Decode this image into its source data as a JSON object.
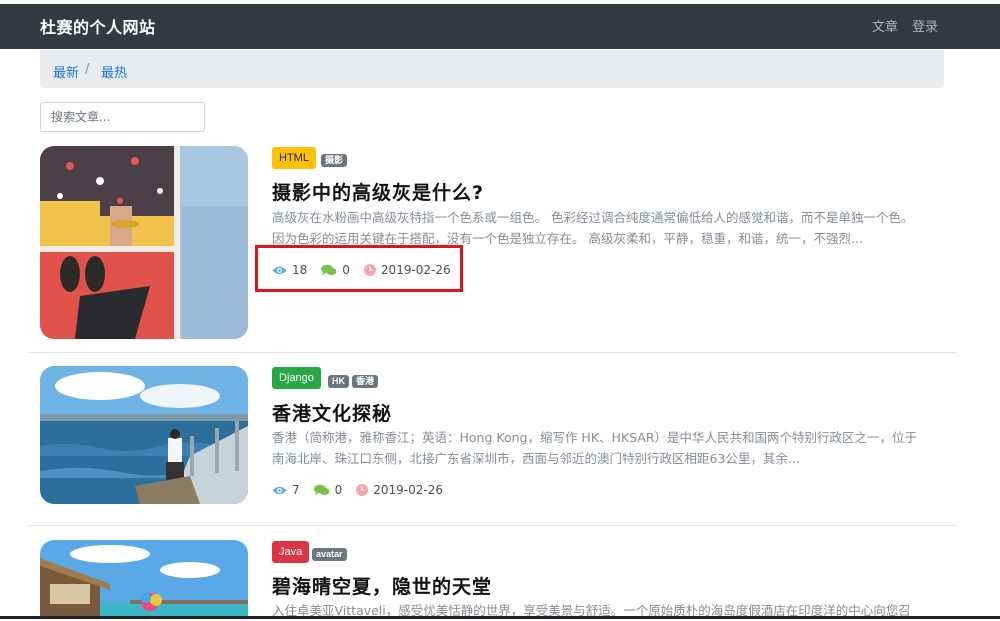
{
  "navbar": {
    "brand": "杜赛的个人网站",
    "links": [
      "文章",
      "登录"
    ]
  },
  "breadcrumb": {
    "items": [
      "最新",
      "最热"
    ],
    "separator": "/"
  },
  "search": {
    "placeholder": "搜索文章..."
  },
  "articles": [
    {
      "category": "HTML",
      "category_color": "#ffc107",
      "category_text_color": "#212529",
      "tags": [
        "摄影"
      ],
      "title": "摄影中的高级灰是什么?",
      "excerpt": [
        "高级灰在水粉画中高级灰特指一个色系或一组色。 色彩经过调合纯度通常偏低给人的感觉和谐，而不是单独一个色。",
        "因为色彩的运用关键在于搭配，没有一个色是独立存在。 高级灰柔和，平静，稳重，和谐，统一，不强烈..."
      ],
      "views": "18",
      "comments": "0",
      "date": "2019-02-26"
    },
    {
      "category": "Django",
      "category_color": "#28a745",
      "category_text_color": "#ffffff",
      "tags": [
        "HK",
        "香港"
      ],
      "title": "香港文化探秘",
      "excerpt": [
        "香港（简称港，雅称香江；英语：Hong Kong，缩写作 HK、HKSAR）是中华人民共和国两个特别行政区之一，位于",
        "南海北岸、珠江口东侧，北接广东省深圳市，西面与邻近的澳门特别行政区相距63公里，其余..."
      ],
      "views": "7",
      "comments": "0",
      "date": "2019-02-26"
    },
    {
      "category": "Java",
      "category_color": "#dc3545",
      "category_text_color": "#ffffff",
      "tags": [
        "avatar"
      ],
      "title": "碧海晴空夏，隐世的天堂",
      "excerpt": [
        "入住卓美亚Vittaveli，感受优美恬静的世界，享受美景与舒适。一个原始质朴的海岛度假酒店在印度洋的中心向您召"
      ]
    }
  ],
  "colors": {
    "eye": "#5dade2",
    "comment": "#7cc04b",
    "clock": "#f1a7ad",
    "link": "#1a73e8",
    "highlight": "#e0121c"
  }
}
